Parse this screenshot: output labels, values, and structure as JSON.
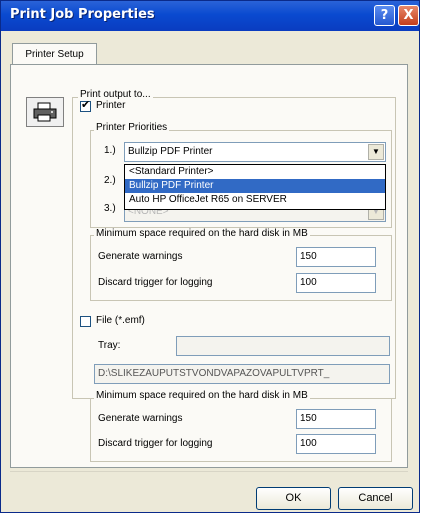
{
  "window": {
    "title": "Print Job Properties",
    "help_label": "?",
    "close_label": "X"
  },
  "tabs": [
    {
      "label": "Printer Setup",
      "active": true
    }
  ],
  "print_output": {
    "group_label": "Print output to...",
    "printer_checkbox": {
      "label": "Printer",
      "checked": true
    },
    "priorities": {
      "group_label": "Printer Priorities",
      "rows": [
        {
          "label": "1.)",
          "value": "Bullzip PDF Printer"
        },
        {
          "label": "2.)",
          "value": ""
        },
        {
          "label": "3.)",
          "value": "<NONE>"
        }
      ],
      "dropdown_options": [
        {
          "label": "<Standard Printer>",
          "selected": false
        },
        {
          "label": "Bullzip PDF Printer",
          "selected": true
        },
        {
          "label": "Auto HP OfficeJet R65 on SERVER",
          "selected": false
        }
      ]
    },
    "printer_disk": {
      "group_label": "Minimum space required on the hard disk in MB",
      "generate_warnings_label": "Generate warnings",
      "generate_warnings_value": "150",
      "discard_trigger_label": "Discard trigger for logging",
      "discard_trigger_value": "100"
    },
    "file_checkbox": {
      "label": "File  (*.emf)",
      "checked": false
    },
    "tray_label": "Tray:",
    "tray_value": "",
    "path_value": "D:\\SLIKEZAUPUTSTVONDVAPAZOVAPULTVPRT_",
    "file_disk": {
      "group_label": "Minimum space required on the hard disk in MB",
      "generate_warnings_label": "Generate warnings",
      "generate_warnings_value": "150",
      "discard_trigger_label": "Discard trigger for logging",
      "discard_trigger_value": "100"
    }
  },
  "buttons": {
    "ok_label": "OK",
    "cancel_label": "Cancel"
  },
  "colors": {
    "titlebar": "#0a4ad0",
    "selection": "#316ac5",
    "close_button": "#c43e1c",
    "dialog_bg": "#ece9d8",
    "panel_bg": "#fbfaf6"
  },
  "icons": {
    "printer": "printer-icon"
  }
}
